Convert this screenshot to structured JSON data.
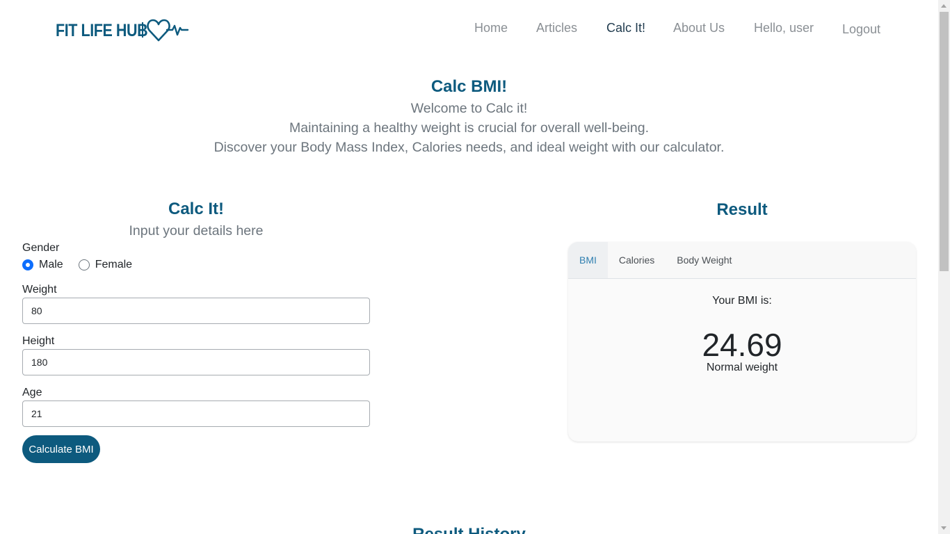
{
  "brand": {
    "logo_text": "FIT LIFE HUB",
    "logo_icon": "heart-pulse-icon",
    "color": "#0d5a7e"
  },
  "nav": {
    "home": "Home",
    "articles": "Articles",
    "calc": "Calc It!",
    "about": "About Us",
    "greeting": "Hello, user",
    "logout": "Logout",
    "active": "calc"
  },
  "hero": {
    "title": "Calc BMI!",
    "line1": "Welcome to Calc it!",
    "line2": "Maintaining a healthy weight is crucial for overall well-being.",
    "line3": "Discover your Body Mass Index, Calories needs, and ideal weight with our calculator."
  },
  "form": {
    "title": "Calc It!",
    "subtitle": "Input your details here",
    "gender_label": "Gender",
    "gender_options": [
      "Male",
      "Female"
    ],
    "gender_selected": "Male",
    "weight_label": "Weight",
    "weight_value": "80",
    "height_label": "Height",
    "height_value": "180",
    "age_label": "Age",
    "age_value": "21",
    "submit_label": "Calculate BMI"
  },
  "result": {
    "title": "Result",
    "tabs": [
      "BMI",
      "Calories",
      "Body Weight"
    ],
    "active_tab": "BMI",
    "caption": "Your BMI is:",
    "bmi_value": "24.69",
    "category": "Normal weight"
  },
  "history": {
    "title": "Result History"
  },
  "colors": {
    "primary": "#0d5a7e",
    "radio_checked": "#0d6efd",
    "active_tab_text": "#2f7fb0",
    "muted_text": "#6c757d"
  }
}
